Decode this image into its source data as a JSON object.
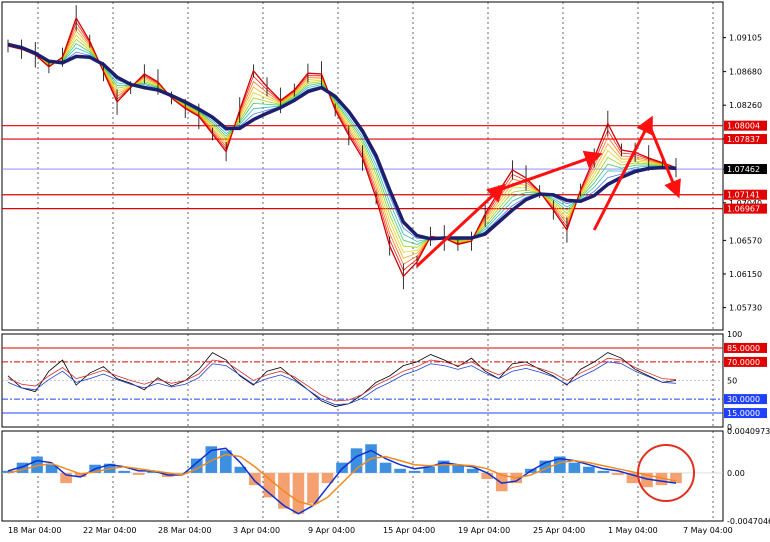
{
  "chart_data": [
    {
      "type": "line",
      "panel": "price",
      "ylim": [
        1.0545,
        1.0955
      ],
      "y_ticks": [
        1.09105,
        1.0868,
        1.0826,
        1.0784,
        1.0746,
        1.0704,
        1.0657,
        1.0615,
        1.0573
      ],
      "y_tick_labels": [
        "1.09105",
        "1.08680",
        "1.08260",
        "1.07840",
        "1.07462",
        "1.07040",
        "1.06570",
        "1.06150",
        "1.05730"
      ],
      "x_tick_labels": [
        "18 Mar 04:00",
        "22 Mar 04:00",
        "28 Mar 04:00",
        "3 Apr 04:00",
        "9 Apr 04:00",
        "15 Apr 04:00",
        "19 Apr 04:00",
        "25 Apr 04:00",
        "1 May 04:00",
        "7 May 04:00"
      ],
      "horizontal_levels": [
        {
          "label": "1.08004",
          "value": 1.08004,
          "color": "#e00000"
        },
        {
          "label": "1.07837",
          "value": 1.07837,
          "color": "#e00000"
        },
        {
          "label": "1.07141",
          "value": 1.07141,
          "color": "#e00000"
        },
        {
          "label": "1.06967",
          "value": 1.06967,
          "color": "#e00000"
        }
      ],
      "current_price": {
        "label": "1.07462",
        "value": 1.07462,
        "color": "#000000"
      },
      "current_line_color": "#8080ff",
      "series": [
        {
          "values": [
            1.09,
            1.0896,
            1.0889,
            1.0874,
            1.0886,
            1.0935,
            1.0906,
            1.0868,
            1.083,
            1.0848,
            1.0865,
            1.0855,
            1.0835,
            1.0822,
            1.0812,
            1.079,
            1.0768,
            1.082,
            1.0869,
            1.0849,
            1.0832,
            1.0845,
            1.0866,
            1.0865,
            1.082,
            1.0788,
            1.076,
            1.071,
            1.065,
            1.0612,
            1.063,
            1.0662,
            1.066,
            1.0652,
            1.0656,
            1.069,
            1.0718,
            1.0745,
            1.0735,
            1.0718,
            1.0695,
            1.067,
            1.072,
            1.076,
            1.0803,
            1.077,
            1.0767,
            1.076,
            1.0754,
            1.0748
          ]
        },
        {
          "values": [
            1.0902,
            1.0898,
            1.0891,
            1.0881,
            1.0879,
            1.0887,
            1.0886,
            1.0877,
            1.0861,
            1.0852,
            1.0848,
            1.0845,
            1.0838,
            1.083,
            1.0821,
            1.0811,
            1.0797,
            1.0797,
            1.0808,
            1.0816,
            1.0823,
            1.0832,
            1.0843,
            1.0848,
            1.0837,
            1.0818,
            1.0794,
            1.0763,
            1.072,
            1.068,
            1.0663,
            1.0659,
            1.066,
            1.066,
            1.066,
            1.0665,
            1.068,
            1.0695,
            1.0708,
            1.0715,
            1.0714,
            1.0707,
            1.0706,
            1.0713,
            1.0727,
            1.0736,
            1.0743,
            1.0747,
            1.0748,
            1.0747
          ]
        }
      ],
      "annotations": [
        "trend arrows (red)",
        "circle highlight on histogram"
      ]
    },
    {
      "type": "line",
      "panel": "oscillator",
      "ylim": [
        0,
        100
      ],
      "y_tick_labels": [
        "100",
        "50",
        "0"
      ],
      "levels": [
        {
          "label": "85.0000",
          "value": 85,
          "color": "#e00000"
        },
        {
          "label": "70.0000",
          "value": 70,
          "color": "#e00000"
        },
        {
          "label": "30.0000",
          "value": 30,
          "color": "#2040ff"
        },
        {
          "label": "15.0000",
          "value": 15,
          "color": "#2040ff"
        }
      ],
      "series": [
        {
          "values": [
            55,
            42,
            38,
            60,
            72,
            45,
            58,
            65,
            52,
            47,
            40,
            53,
            44,
            50,
            62,
            80,
            72,
            55,
            45,
            60,
            64,
            52,
            40,
            28,
            22,
            25,
            35,
            48,
            55,
            66,
            70,
            78,
            72,
            65,
            74,
            60,
            52,
            68,
            70,
            62,
            55,
            45,
            62,
            70,
            80,
            74,
            62,
            55,
            48,
            50
          ]
        },
        {
          "values": [
            52,
            46,
            44,
            55,
            64,
            52,
            56,
            61,
            55,
            50,
            46,
            51,
            47,
            50,
            57,
            72,
            70,
            60,
            50,
            56,
            60,
            54,
            44,
            34,
            28,
            29,
            35,
            45,
            52,
            60,
            65,
            72,
            70,
            66,
            70,
            62,
            56,
            64,
            67,
            63,
            58,
            50,
            58,
            65,
            74,
            72,
            64,
            58,
            52,
            51
          ]
        }
      ]
    },
    {
      "type": "bar",
      "panel": "histogram",
      "ylim": [
        -0.0047046,
        0.0040973
      ],
      "y_tick_labels": [
        "0.0040973",
        "0.00",
        "-0.0047046"
      ],
      "values": [
        0.0002,
        0.001,
        0.0016,
        0.0008,
        -0.001,
        -0.0004,
        0.0008,
        0.0009,
        0.0002,
        -0.0002,
        0.0002,
        -0.0004,
        -0.0001,
        0.0014,
        0.0026,
        0.0022,
        0.0006,
        -0.0012,
        -0.0024,
        -0.0035,
        -0.004,
        -0.003,
        -0.001,
        0.001,
        0.0024,
        0.0028,
        0.001,
        0.0004,
        0.0002,
        0.0006,
        0.0012,
        0.0008,
        0.0004,
        -0.0006,
        -0.0018,
        -0.001,
        0.0004,
        0.0012,
        0.0016,
        0.001,
        0.0006,
        0.0002,
        -0.0002,
        -0.001,
        -0.0014,
        -0.0012,
        -0.001
      ],
      "series": [
        {
          "values": [
            0.0002,
            0.0006,
            0.0012,
            0.001,
            -0.0002,
            -0.0004,
            0.0004,
            0.0008,
            0.0006,
            0.0002,
            0.0002,
            -0.0002,
            -0.0002,
            0.001,
            0.0022,
            0.0024,
            0.001,
            -0.0008,
            -0.002,
            -0.0032,
            -0.004,
            -0.0032,
            -0.0014,
            0.0004,
            0.0016,
            0.0022,
            0.0014,
            0.0008,
            0.0004,
            0.0006,
            0.001,
            0.0008,
            0.0006,
            0.0,
            -0.001,
            -0.0008,
            0.0002,
            0.001,
            0.0014,
            0.0012,
            0.0008,
            0.0004,
            0.0002,
            -0.0002,
            -0.0006,
            -0.0008,
            -0.001
          ]
        },
        {
          "values": [
            0.0,
            0.0003,
            0.0007,
            0.0009,
            0.0004,
            -0.0001,
            0.0001,
            0.0004,
            0.0006,
            0.0004,
            0.0002,
            0.0,
            -0.0002,
            0.0004,
            0.0012,
            0.0018,
            0.0016,
            0.0006,
            -0.0006,
            -0.0018,
            -0.0028,
            -0.0032,
            -0.0024,
            -0.001,
            0.0004,
            0.0014,
            0.0016,
            0.0012,
            0.0008,
            0.0007,
            0.0008,
            0.0008,
            0.0007,
            0.0004,
            -0.0002,
            -0.0005,
            -0.0002,
            0.0004,
            0.001,
            0.0012,
            0.001,
            0.0007,
            0.0004,
            0.0001,
            -0.0002,
            -0.0005,
            -0.0008
          ]
        }
      ]
    }
  ],
  "colors": {
    "ma_slow": "#1e1e6e",
    "price_line": "#d00000",
    "histogram_pos": "#3d8fe0",
    "histogram_neg": "#f4a070",
    "signal_blue": "#1030d0",
    "signal_orange": "#f08a20",
    "arrow_red": "#ff1010"
  }
}
